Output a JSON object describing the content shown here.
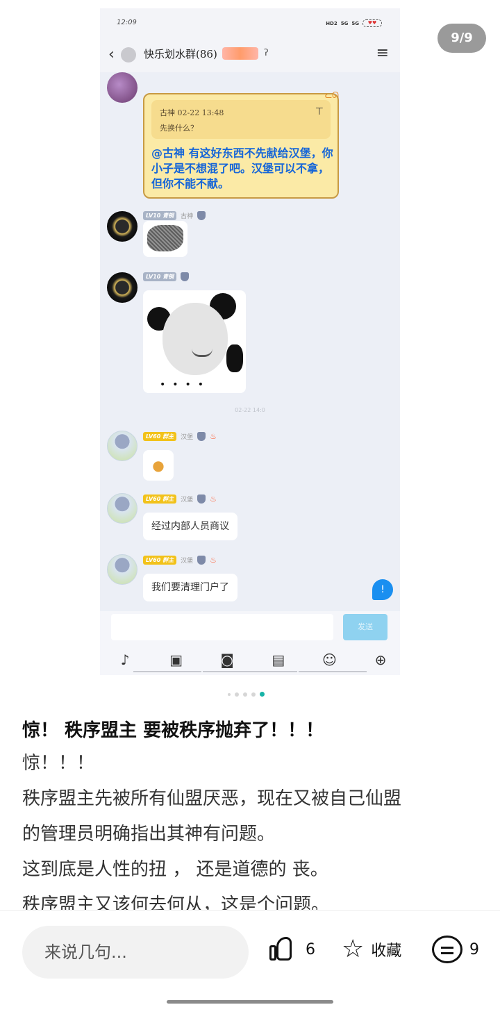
{
  "image_counter": "9/9",
  "screenshot": {
    "status_time": "12:09",
    "status_chips": [
      "HD2",
      "5G",
      "5G"
    ],
    "battery": "♥♥",
    "group_title": "快乐划水群(86)",
    "quote": {
      "meta": "古神 02-22 13:48",
      "text": "先换什么？"
    },
    "scroll_message": "@古神 有这好东西不先献给汉堡，你小子是不想混了吧。汉堡可以不拿，但你不能不献。",
    "level_grey": "LV10 青铜",
    "nick_gushen": "古神",
    "level_gold": "LV60 群主",
    "nick_hanbao": "汉堡",
    "timestamp": "02-22 14:0",
    "msg_1": "经过内部人员商议",
    "msg_2": "我们要清理门户了",
    "send_label": "发送"
  },
  "post": {
    "title": "惊！ 秩序盟主 要被秩序抛弃了！！！",
    "lines": [
      "惊！！！",
      "秩序盟主先被所有仙盟厌恶，现在又被自己仙盟",
      "的管理员明确指出其神有问题。",
      "这到底是人性的扭 ， 还是道德的 丧。",
      "秩序盟主又该何去何从，这是个问题。"
    ]
  },
  "bottom": {
    "comment_placeholder": "来说几句...",
    "like_count": "6",
    "favorite_label": "收藏",
    "comment_count": "9"
  }
}
